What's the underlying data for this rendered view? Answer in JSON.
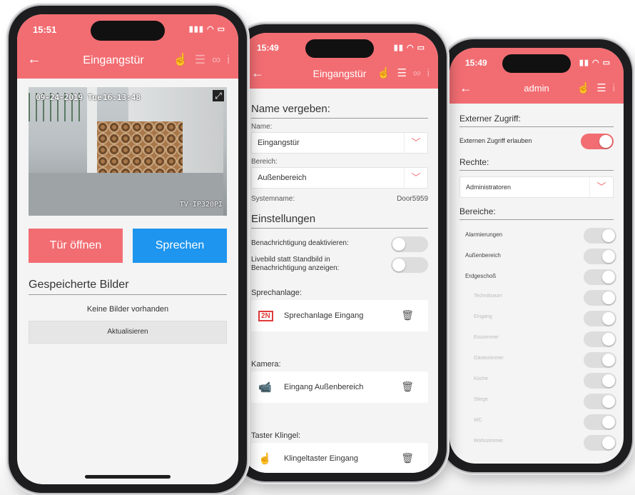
{
  "phone1": {
    "time": "15:51",
    "signal": "▮▮▮ ◠ ▭",
    "nav_title": "Eingangstür",
    "camera_timestamp_date": "09-24-2019 Tue",
    "camera_timestamp_time": "16:13:48",
    "camera_label": "TV-IP320PI",
    "open_door_label": "Tür öffnen",
    "speak_label": "Sprechen",
    "saved_images_heading": "Gespeicherte Bilder",
    "no_images_text": "Keine Bilder vorhanden",
    "refresh_label": "Aktualisieren"
  },
  "phone2": {
    "time": "15:49",
    "signal": "▮▮ ◠ ▭",
    "nav_title": "Eingangstür",
    "name_heading": "Name vergeben:",
    "name_label": "Name:",
    "name_value": "Eingangstür",
    "area_label": "Bereich:",
    "area_value": "Außenbereich",
    "system_name_label": "Systemname:",
    "system_name_value": "Door5959",
    "settings_heading": "Einstellungen",
    "disable_notification_label": "Benachrichtigung deaktivieren:",
    "live_image_label": "Livebild statt Standbild in Benachrichtigung anzeigen:",
    "intercom_heading": "Sprechanlage:",
    "intercom_item": "Sprechanlage Eingang",
    "camera_heading": "Kamera:",
    "camera_item": "Eingang Außenbereich",
    "bell_heading": "Taster Klingel:",
    "bell_item": "Klingeltaster Eingang"
  },
  "phone3": {
    "time": "15:49",
    "signal": "▮▮ ◠ ▭",
    "nav_title": "admin",
    "external_heading": "Externer Zugriff:",
    "external_allow_label": "Externen Zugriff erlauben",
    "rights_heading": "Rechte:",
    "rights_value": "Administratoren",
    "areas_heading": "Bereiche:",
    "areas": [
      {
        "label": "Alarmierungen",
        "sub": false
      },
      {
        "label": "Außenbereich",
        "sub": false
      },
      {
        "label": "Erdgeschoß",
        "sub": false
      },
      {
        "label": "Technikraum",
        "sub": true
      },
      {
        "label": "Eingang",
        "sub": true
      },
      {
        "label": "Esszimmer",
        "sub": true
      },
      {
        "label": "Gästezimmer",
        "sub": true
      },
      {
        "label": "Küche",
        "sub": true
      },
      {
        "label": "Stiege",
        "sub": true
      },
      {
        "label": "WC",
        "sub": true
      },
      {
        "label": "Wohnzimmer",
        "sub": true
      }
    ]
  },
  "colors": {
    "accent": "#f26d72",
    "speak_blue": "#1e95ee",
    "screen_bg": "#f4f4f4"
  }
}
